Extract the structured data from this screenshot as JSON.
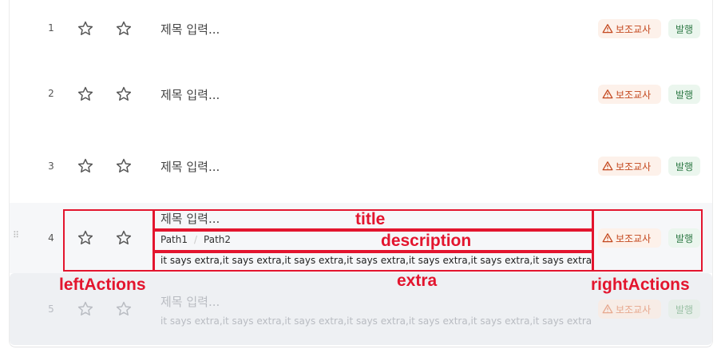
{
  "rows": [
    {
      "num": "1",
      "title": "제목 입력...",
      "warn": "보조교사",
      "status": "발행"
    },
    {
      "num": "2",
      "title": "제목 입력...",
      "warn": "보조교사",
      "status": "발행"
    },
    {
      "num": "3",
      "title": "제목 입력...",
      "warn": "보조교사",
      "status": "발행"
    },
    {
      "num": "4",
      "title": "제목 입력...",
      "warn": "보조교사",
      "status": "발행",
      "breadcrumb": [
        "Path1",
        "Path2"
      ],
      "extra": "it says extra,it says extra,it says extra,it says extra,it says extra,it says extra,it says extra"
    },
    {
      "num": "5",
      "title": "제목 입력...",
      "warn": "보조교사",
      "status": "발행",
      "extra": "it says extra,it says extra,it says extra,it says extra,it says extra,it says extra,it says extra"
    }
  ],
  "annotations": {
    "title": "title",
    "description": "description",
    "extra": "extra",
    "leftActions": "leftActions",
    "rightActions": "rightActions"
  },
  "colors": {
    "annotation": "#e3152e",
    "warn": "#c4481e",
    "publish": "#2f7a46"
  },
  "icons": {
    "star": "star-outline-icon",
    "warning": "warning-triangle-icon",
    "drag": "drag-handle-icon"
  }
}
